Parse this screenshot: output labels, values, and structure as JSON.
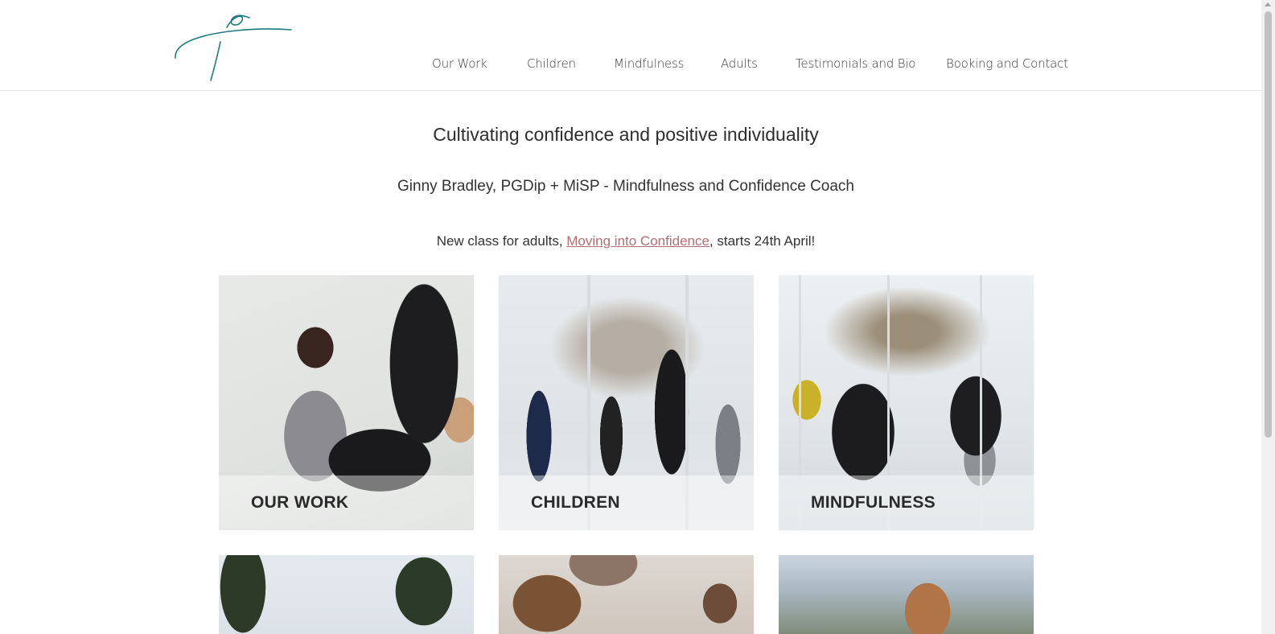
{
  "header": {
    "logo": "brand-logo-signature",
    "nav": [
      {
        "label": "Our Work"
      },
      {
        "label": "Children"
      },
      {
        "label": "Mindfulness"
      },
      {
        "label": "Adults"
      },
      {
        "label": "Testimonials and Bio"
      },
      {
        "label": "Booking and Contact"
      }
    ]
  },
  "intro": {
    "tagline": "Cultivating confidence and positive individuality",
    "subtitle": "Ginny Bradley, PGDip + MiSP - Mindfulness and Confidence Coach",
    "announcement_prefix": "New class for adults, ",
    "announcement_link": "Moving into Confidence",
    "announcement_suffix": ", starts 24th April!"
  },
  "tiles": [
    {
      "caption": "OUR WORK"
    },
    {
      "caption": "CHILDREN"
    },
    {
      "caption": "MINDFULNESS"
    },
    {
      "caption": ""
    },
    {
      "caption": ""
    },
    {
      "caption": ""
    }
  ],
  "colors": {
    "logo": "#1f7a80",
    "link": "#b36e72",
    "text": "#2e2e2e"
  }
}
